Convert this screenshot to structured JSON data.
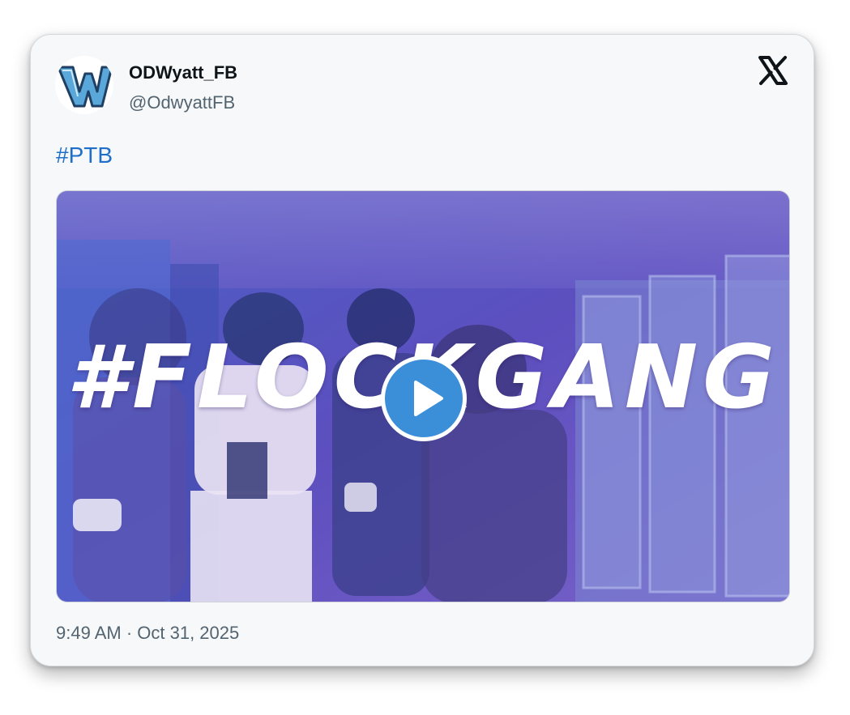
{
  "tweet": {
    "display_name": "ODWyatt_FB",
    "handle": "@OdwyattFB",
    "text": "#PTB",
    "timestamp": "9:49 AM · Oct 31, 2025"
  },
  "media": {
    "type": "video",
    "overlay_text": "#FLOCKGANG"
  },
  "icons": {
    "avatar": "w-logo-avatar",
    "brand": "x-logo-icon",
    "play": "play-icon"
  },
  "colors": {
    "hashtag": "#1d6fc9",
    "play_button": "#3b8fd9",
    "video_tint": "#5a4fb8"
  }
}
